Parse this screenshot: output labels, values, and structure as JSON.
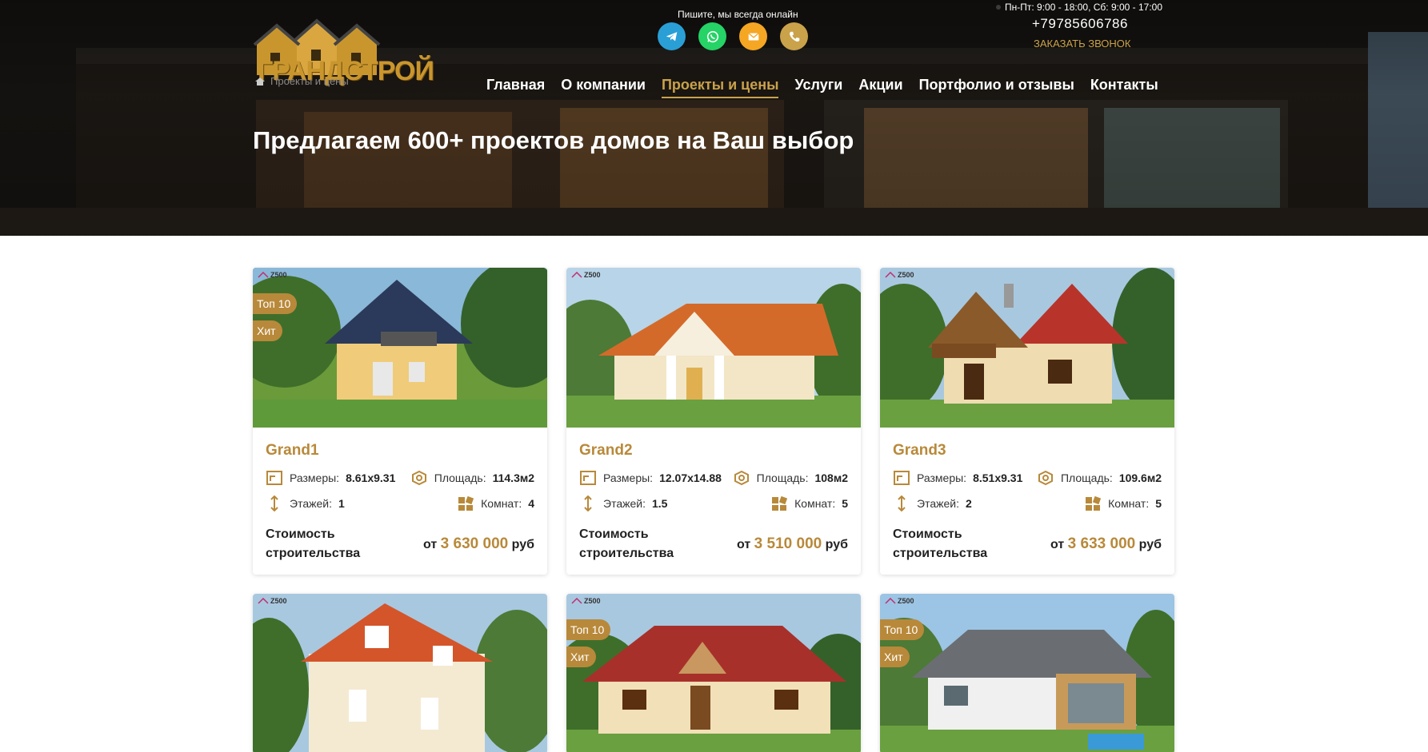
{
  "header": {
    "logo_text": "ГРАНДСТРОЙ",
    "breadcrumb": [
      "Проекты и цены"
    ],
    "online_text": "Пишите, мы всегда онлайн",
    "contact_icons": [
      "telegram-icon",
      "whatsapp-icon",
      "email-icon",
      "phone-icon"
    ],
    "hours": "Пн-Пт: 9:00 - 18:00, Сб: 9:00 - 17:00",
    "phone": "+79785606786",
    "callback_label": "ЗАКАЗАТЬ ЗВОНОК"
  },
  "nav": {
    "items": [
      "Главная",
      "О компании",
      "Проекты и цены",
      "Услуги",
      "Акции",
      "Портфолио и отзывы",
      "Контакты"
    ],
    "active": "Проекты и цены"
  },
  "hero": {
    "title": "Предлагаем 600+ проектов домов на Ваш выбор"
  },
  "labels": {
    "size": "Размеры:",
    "area": "Площадь:",
    "floors": "Этажей:",
    "rooms": "Комнат:",
    "price_label": "Стоимость строительства",
    "price_prefix": "от",
    "price_suffix": "руб",
    "watermark": "Z500"
  },
  "projects": [
    {
      "name": "Grand1",
      "size": "8.61x9.31",
      "area": "114.3м2",
      "floors": "1",
      "rooms": "4",
      "price": "3 630 000",
      "badges": [
        "Топ 10",
        "Хит"
      ]
    },
    {
      "name": "Grand2",
      "size": "12.07x14.88",
      "area": "108м2",
      "floors": "1.5",
      "rooms": "5",
      "price": "3 510 000",
      "badges": []
    },
    {
      "name": "Grand3",
      "size": "8.51x9.31",
      "area": "109.6м2",
      "floors": "2",
      "rooms": "5",
      "price": "3 633 000",
      "badges": []
    },
    {
      "badges": []
    },
    {
      "badges": [
        "Топ 10",
        "Хит"
      ]
    },
    {
      "badges": [
        "Топ 10",
        "Хит"
      ]
    }
  ],
  "colors": {
    "accent": "#b8893a",
    "nav_active": "#c9a24a",
    "telegram": "#2a9fd6",
    "whatsapp": "#25d366",
    "email": "#f5a623",
    "phone_btn": "#c9a24a"
  }
}
